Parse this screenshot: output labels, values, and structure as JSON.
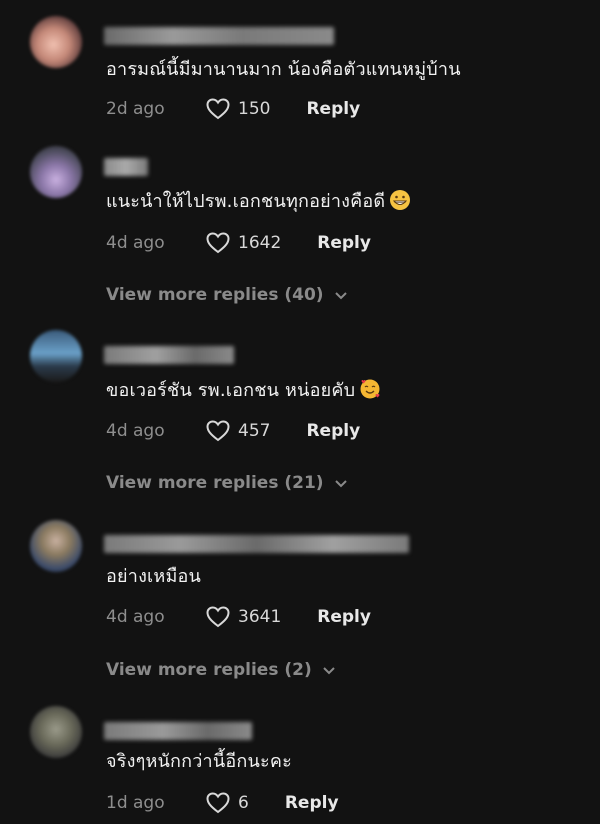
{
  "colors": {
    "background": "#121212",
    "text": "#f2f2f2",
    "muted": "#8e8e8e"
  },
  "comments": [
    {
      "text": "อารมณ์นี้มีมานานมาก น้องคือตัวแทนหมู่บ้าน",
      "time": "2d ago",
      "likes": "150",
      "reply": "Reply"
    },
    {
      "text": "แนะนำให้ไปรพ.เอกชนทุกอย่างคือดี",
      "emoji": "grinning-face-emoji",
      "time": "4d ago",
      "likes": "1642",
      "reply": "Reply",
      "view_more": "View more replies (40)"
    },
    {
      "text": "ขอเวอร์ชัน รพ.เอกชน หน่อยคับ",
      "emoji": "smiling-face-with-hearts-emoji",
      "time": "4d ago",
      "likes": "457",
      "reply": "Reply",
      "view_more": "View more replies (21)"
    },
    {
      "text": "อย่างเหมือน",
      "time": "4d ago",
      "likes": "3641",
      "reply": "Reply",
      "view_more": "View more replies (2)"
    },
    {
      "text": "จริงๆหนักกว่านี้อีกนะคะ",
      "time": "1d ago",
      "likes": "6",
      "reply": "Reply"
    }
  ]
}
